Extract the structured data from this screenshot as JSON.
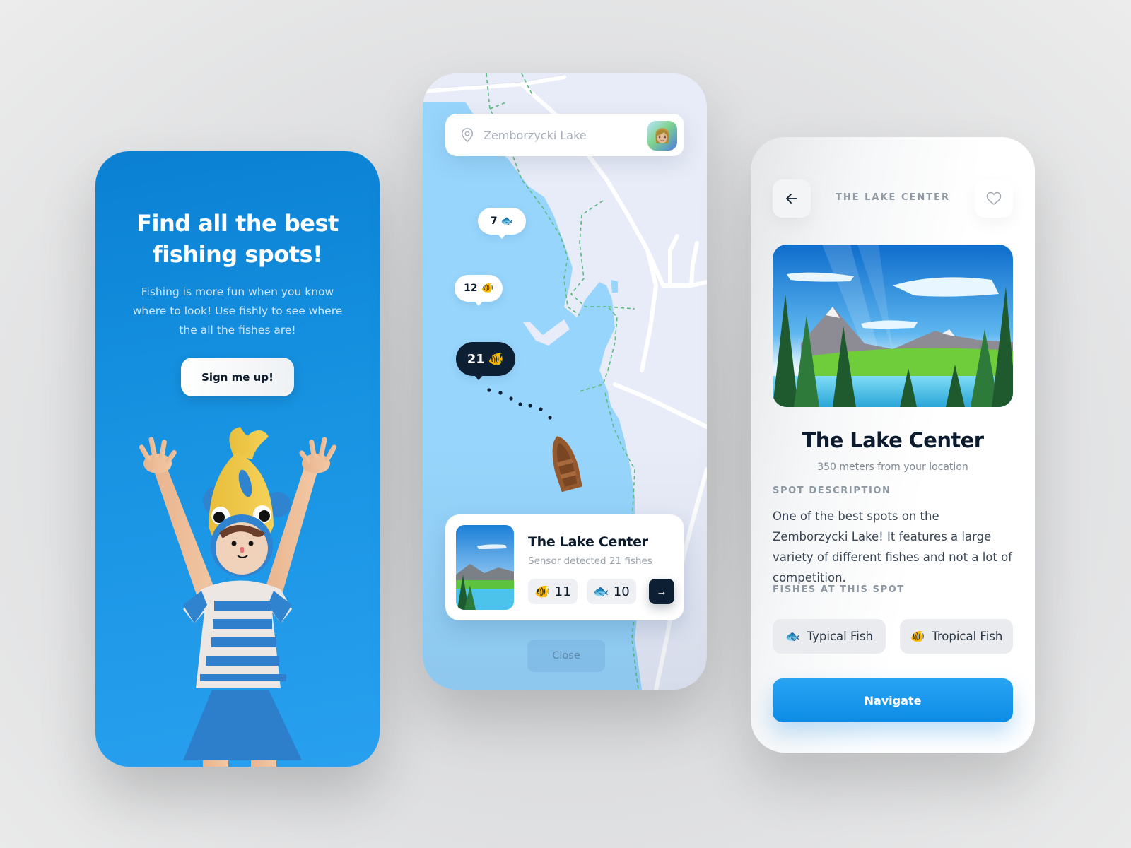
{
  "onboarding": {
    "title_line1": "Find all the best",
    "title_line2": "fishing spots!",
    "description": "Fishing is more fun when you know where to look! Use fishly to see where the all the fishes are!",
    "signup_label": "Sign me up!",
    "colors": {
      "background_top": "#0b80d3",
      "background_bottom": "#28a0ef"
    }
  },
  "map": {
    "search": {
      "value": "",
      "placeholder": "Zemborzycki Lake",
      "icon": "location-pin-icon"
    },
    "avatar_emoji": "👩🏼",
    "markers": [
      {
        "count": "7",
        "fish_emoji": "🐟",
        "style": "light"
      },
      {
        "count": "12",
        "fish_emoji": "🐠",
        "style": "light"
      },
      {
        "count": "21",
        "fish_emoji": "🐠",
        "style": "dark"
      }
    ],
    "spot_card": {
      "title": "The Lake Center",
      "subtitle": "Sensor detected 21 fishes",
      "counts": [
        {
          "fish_emoji": "🐠",
          "value": "11"
        },
        {
          "fish_emoji": "🐟",
          "value": "10"
        }
      ],
      "go_icon": "→"
    },
    "close_label": "Close",
    "colors": {
      "water": "#97d5fc",
      "land": "#e8ecf8",
      "trail": "#5cba7d"
    }
  },
  "detail": {
    "header_title": "THE LAKE CENTER",
    "back_icon": "←",
    "title": "The Lake Center",
    "distance": "350 meters from your location",
    "description_label": "SPOT DESCRIPTION",
    "description": "One of the best spots on the Zemborzycki Lake! It features a large variety of different fishes and not a lot of competition.",
    "fishes_label": "FISHES AT THIS SPOT",
    "fishes": [
      {
        "emoji": "🐟",
        "name": "Typical Fish"
      },
      {
        "emoji": "🐠",
        "name": "Tropical Fish"
      }
    ],
    "navigate_label": "Navigate",
    "colors": {
      "primary": "#1a96ea",
      "text_dark": "#0b1a2c"
    }
  }
}
